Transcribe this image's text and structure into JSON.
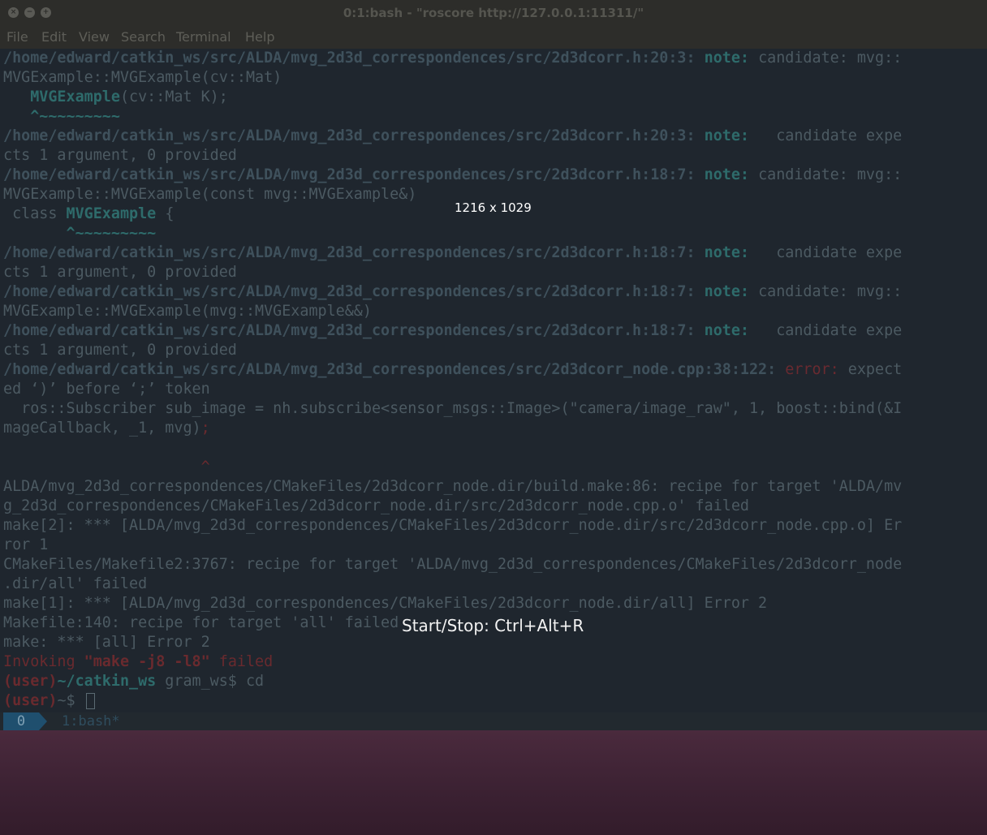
{
  "window": {
    "title": "0:1:bash - \"roscore http://127.0.0.1:11311/\"",
    "buttons": [
      "×",
      "−",
      "+"
    ]
  },
  "menu": [
    "File",
    "Edit",
    "View",
    "Search",
    "Terminal",
    "Help"
  ],
  "terminal": {
    "lines": [
      [
        {
          "t": "/home/edward/catkin_ws/src/ALDA/mvg_2d3d_correspondences/src/2d3dcorr.h:20:3: ",
          "c": "path"
        },
        {
          "t": "note:",
          "c": "note"
        },
        {
          "t": " candidate: mvg::",
          "c": ""
        }
      ],
      [
        {
          "t": "MVGExample::MVGExample(cv::Mat)",
          "c": ""
        }
      ],
      [
        {
          "t": "   ",
          "c": ""
        },
        {
          "t": "MVGExample",
          "c": "teal"
        },
        {
          "t": "(cv::Mat K);",
          "c": ""
        }
      ],
      [
        {
          "t": "   ^~~~~~~~~~",
          "c": "teal"
        }
      ],
      [
        {
          "t": "/home/edward/catkin_ws/src/ALDA/mvg_2d3d_correspondences/src/2d3dcorr.h:20:3: ",
          "c": "path"
        },
        {
          "t": "note:",
          "c": "note"
        },
        {
          "t": "   candidate expe",
          "c": ""
        }
      ],
      [
        {
          "t": "cts 1 argument, 0 provided",
          "c": ""
        }
      ],
      [
        {
          "t": "/home/edward/catkin_ws/src/ALDA/mvg_2d3d_correspondences/src/2d3dcorr.h:18:7: ",
          "c": "path"
        },
        {
          "t": "note:",
          "c": "note"
        },
        {
          "t": " candidate: mvg::",
          "c": ""
        }
      ],
      [
        {
          "t": "MVGExample::MVGExample(const mvg::MVGExample&)",
          "c": ""
        }
      ],
      [
        {
          "t": " class ",
          "c": ""
        },
        {
          "t": "MVGExample",
          "c": "teal"
        },
        {
          "t": " {",
          "c": ""
        }
      ],
      [
        {
          "t": "       ^~~~~~~~~~",
          "c": "teal"
        }
      ],
      [
        {
          "t": "/home/edward/catkin_ws/src/ALDA/mvg_2d3d_correspondences/src/2d3dcorr.h:18:7: ",
          "c": "path"
        },
        {
          "t": "note:",
          "c": "note"
        },
        {
          "t": "   candidate expe",
          "c": ""
        }
      ],
      [
        {
          "t": "cts 1 argument, 0 provided",
          "c": ""
        }
      ],
      [
        {
          "t": "/home/edward/catkin_ws/src/ALDA/mvg_2d3d_correspondences/src/2d3dcorr.h:18:7: ",
          "c": "path"
        },
        {
          "t": "note:",
          "c": "note"
        },
        {
          "t": " candidate: mvg::",
          "c": ""
        }
      ],
      [
        {
          "t": "MVGExample::MVGExample(mvg::MVGExample&&)",
          "c": ""
        }
      ],
      [
        {
          "t": "/home/edward/catkin_ws/src/ALDA/mvg_2d3d_correspondences/src/2d3dcorr.h:18:7: ",
          "c": "path"
        },
        {
          "t": "note:",
          "c": "note"
        },
        {
          "t": "   candidate expe",
          "c": ""
        }
      ],
      [
        {
          "t": "cts 1 argument, 0 provided",
          "c": ""
        }
      ],
      [
        {
          "t": "/home/edward/catkin_ws/src/ALDA/mvg_2d3d_correspondences/src/2d3dcorr_node.cpp:38:122: ",
          "c": "path"
        },
        {
          "t": "error:",
          "c": "err"
        },
        {
          "t": " expect",
          "c": ""
        }
      ],
      [
        {
          "t": "ed ‘)’ before ‘;’ token",
          "c": ""
        }
      ],
      [
        {
          "t": "  ros::Subscriber sub_image = nh.subscribe<sensor_msgs::Image>(\"camera/image_raw\", 1, boost::bind(&I",
          "c": ""
        }
      ],
      [
        {
          "t": "mageCallback, _1, mvg)",
          "c": ""
        },
        {
          "t": ";",
          "c": "red"
        }
      ],
      [
        {
          "t": "",
          "c": ""
        }
      ],
      [
        {
          "t": "                      ^",
          "c": "red"
        }
      ],
      [
        {
          "t": "ALDA/mvg_2d3d_correspondences/CMakeFiles/2d3dcorr_node.dir/build.make:86: recipe for target 'ALDA/mv",
          "c": ""
        }
      ],
      [
        {
          "t": "g_2d3d_correspondences/CMakeFiles/2d3dcorr_node.dir/src/2d3dcorr_node.cpp.o' failed",
          "c": ""
        }
      ],
      [
        {
          "t": "make[2]: *** [ALDA/mvg_2d3d_correspondences/CMakeFiles/2d3dcorr_node.dir/src/2d3dcorr_node.cpp.o] Er",
          "c": ""
        }
      ],
      [
        {
          "t": "ror 1",
          "c": ""
        }
      ],
      [
        {
          "t": "CMakeFiles/Makefile2:3767: recipe for target 'ALDA/mvg_2d3d_correspondences/CMakeFiles/2d3dcorr_node",
          "c": ""
        }
      ],
      [
        {
          "t": ".dir/all' failed",
          "c": ""
        }
      ],
      [
        {
          "t": "make[1]: *** [ALDA/mvg_2d3d_correspondences/CMakeFiles/2d3dcorr_node.dir/all] Error 2",
          "c": ""
        }
      ],
      [
        {
          "t": "Makefile:140: recipe for target 'all' failed",
          "c": ""
        }
      ],
      [
        {
          "t": "make: *** [all] Error 2",
          "c": ""
        }
      ],
      [
        {
          "t": "Invoking ",
          "c": "red"
        },
        {
          "t": "\"make -j8 -l8\"",
          "c": "redb"
        },
        {
          "t": " failed",
          "c": "red"
        }
      ],
      [
        {
          "t": "(user)",
          "c": "redb"
        },
        {
          "t": "~/catkin_ws",
          "c": "teal"
        },
        {
          "t": " gram_ws$ cd",
          "c": ""
        }
      ],
      [
        {
          "t": "(user)",
          "c": "redb"
        },
        {
          "t": "~$ ",
          "c": ""
        }
      ]
    ],
    "cursor_line": 33
  },
  "tmux": {
    "session": "0",
    "window": "1:bash*"
  },
  "overlays": {
    "dimensions": "1216 x 1029",
    "recorder": "Start/Stop: Ctrl+Alt+R"
  },
  "colors": {
    "terminal_bg": "#1f262e",
    "note": "#2e6b6b",
    "error": "#6a2a30"
  }
}
